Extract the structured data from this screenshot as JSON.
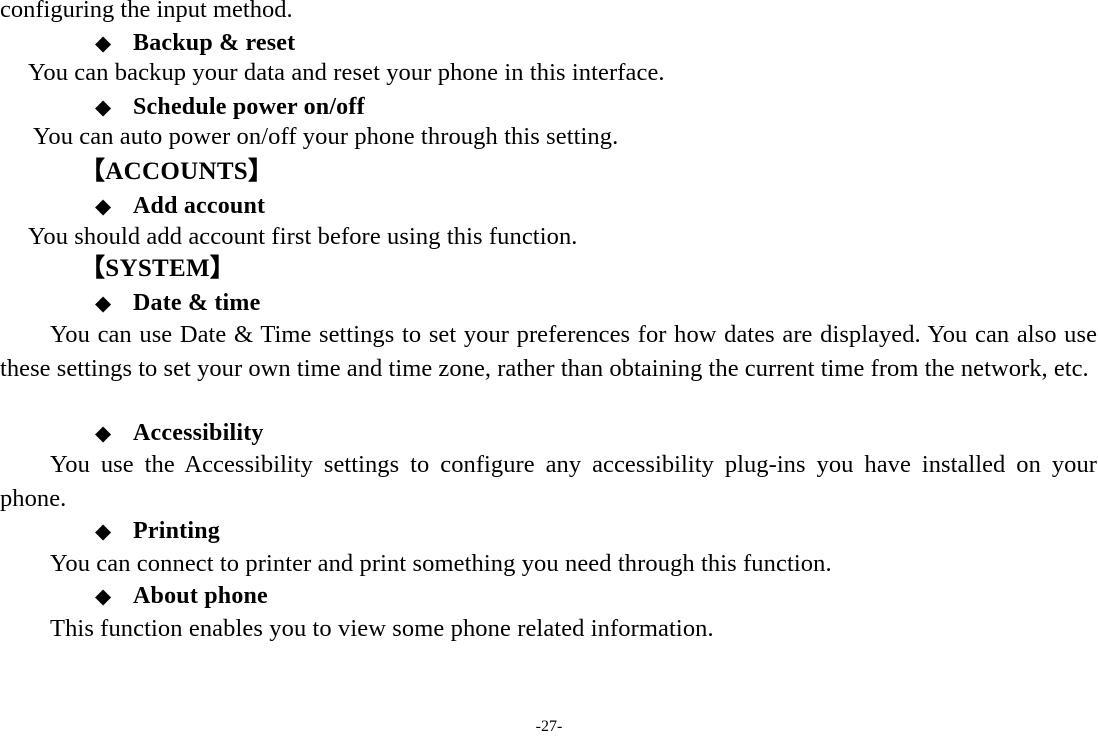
{
  "document": {
    "type": "user-manual-page",
    "page_footer": "-27-",
    "bullet_glyph": "◆",
    "text_color": "#000000",
    "background_color": "#ffffff"
  },
  "continuation": {
    "text": "configuring the input method."
  },
  "entries": [
    {
      "heading": "Backup & reset",
      "body": "You can backup your data and reset your phone in this interface."
    },
    {
      "heading": "Schedule power on/off",
      "body": "You can auto power on/off your phone through this setting."
    },
    {
      "heading": "Add account",
      "body": "You should add account first before using this function."
    },
    {
      "heading": "Date & time",
      "body": "You can use Date & Time settings to set your preferences for how dates are displayed. You can also use these settings to set your own time and time zone, rather than obtaining the current time from the network, etc."
    },
    {
      "heading": "Accessibility",
      "body": "You use the Accessibility settings to configure any accessibility plug-ins you have installed on your phone."
    },
    {
      "heading": "Printing",
      "body": "You can connect to printer and print something you need through this function."
    },
    {
      "heading": "About phone",
      "body": "This function enables you to view some phone related information."
    }
  ],
  "sections": [
    {
      "label": "【ACCOUNTS】"
    },
    {
      "label": "【SYSTEM】"
    }
  ]
}
